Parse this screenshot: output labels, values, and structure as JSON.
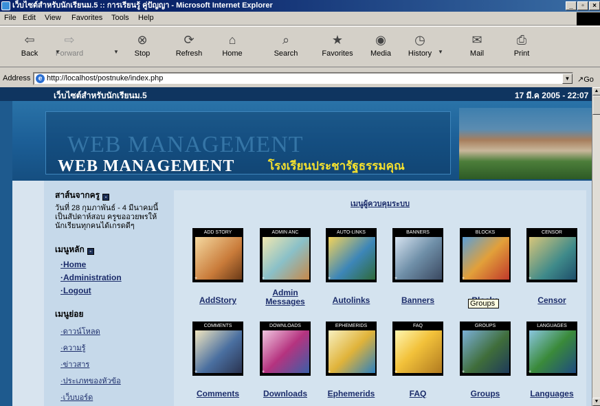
{
  "window": {
    "title": "เว็บไซต์สำหรับนักเรียนม.5 :: การเรียนรู้ คู่ปัญญา - Microsoft Internet Explorer",
    "min": "_",
    "max": "▫",
    "close": "×"
  },
  "menu": [
    "File",
    "Edit",
    "View",
    "Favorites",
    "Tools",
    "Help"
  ],
  "toolbar": [
    {
      "label": "Back",
      "icon": "back-arrow-icon",
      "glyph": "⇦",
      "enabled": true
    },
    {
      "label": "Forward",
      "icon": "forward-arrow-icon",
      "glyph": "⇨",
      "enabled": false
    },
    {
      "label": "Stop",
      "icon": "stop-icon",
      "glyph": "⊗",
      "enabled": true
    },
    {
      "label": "Refresh",
      "icon": "refresh-icon",
      "glyph": "⟳",
      "enabled": true
    },
    {
      "label": "Home",
      "icon": "home-icon",
      "glyph": "⌂",
      "enabled": true
    },
    {
      "label": "Search",
      "icon": "search-icon",
      "glyph": "⌕",
      "enabled": true
    },
    {
      "label": "Favorites",
      "icon": "favorites-icon",
      "glyph": "★",
      "enabled": true
    },
    {
      "label": "Media",
      "icon": "media-icon",
      "glyph": "◉",
      "enabled": true
    },
    {
      "label": "History",
      "icon": "history-icon",
      "glyph": "◷",
      "enabled": true
    },
    {
      "label": "Mail",
      "icon": "mail-icon",
      "glyph": "✉",
      "enabled": true
    },
    {
      "label": "Print",
      "icon": "print-icon",
      "glyph": "⎙",
      "enabled": true
    }
  ],
  "address": {
    "label": "Address",
    "url": "http://localhost/postnuke/index.php",
    "go": "Go"
  },
  "page": {
    "site_title": "เว็บไซต์สำหรับนักเรียนม.5",
    "date": "17 มี.ค 2005 - 22:07",
    "banner_ghost": "WEB MANAGEMENT",
    "banner_title": "WEB MANAGEMENT",
    "school_name": "โรงเรียนประชารัฐธรรมคุณ"
  },
  "sidebar": {
    "teacher_msg_title": "สาส์นจากครู",
    "teacher_msg_text": "วันที่ 28 กุมภาพันธ์ - 4 มีนาคมนี้ เป็นสัปดาห์สอบ ครูขออวยพรให้นักเรียนทุกคนได้เกรดดีๆ",
    "main_menu_title": "เมนูหลัก",
    "main_links": [
      "Home",
      "Administration",
      "Logout"
    ],
    "sub_menu_title": "เมนูย่อย",
    "sub_links": [
      "ดาวน์โหลด",
      "ความรู้",
      "ข่าวสาร",
      "ประเภทของหัวข้อ",
      "เว็บบอร์ด"
    ]
  },
  "admin": {
    "heading": "เมนูผู้ควบคุมระบบ",
    "modules": [
      {
        "tile": "ADD STORY",
        "name": "AddStory",
        "icon": "add-story-icon"
      },
      {
        "tile": "ADMIN ANC",
        "name": "Admin Messages",
        "icon": "admin-messages-icon"
      },
      {
        "tile": "AUTO-LINKS",
        "name": "Autolinks",
        "icon": "autolinks-icon"
      },
      {
        "tile": "BANNERS",
        "name": "Banners",
        "icon": "banners-icon"
      },
      {
        "tile": "BLOCKS",
        "name": "Blocks",
        "icon": "blocks-icon"
      },
      {
        "tile": "CENSOR",
        "name": "Censor",
        "icon": "censor-icon"
      },
      {
        "tile": "COMMENTS",
        "name": "Comments",
        "icon": "comments-icon"
      },
      {
        "tile": "DOWNLOADS",
        "name": "Downloads",
        "icon": "downloads-icon"
      },
      {
        "tile": "EPHEMERIDS",
        "name": "Ephemerids",
        "icon": "ephemerids-icon"
      },
      {
        "tile": "FAQ",
        "name": "FAQ",
        "icon": "faq-icon"
      },
      {
        "tile": "GROUPS",
        "name": "Groups",
        "icon": "groups-icon"
      },
      {
        "tile": "LANGUAGES",
        "name": "Languages",
        "icon": "languages-icon"
      }
    ],
    "tooltip": "Groups"
  }
}
